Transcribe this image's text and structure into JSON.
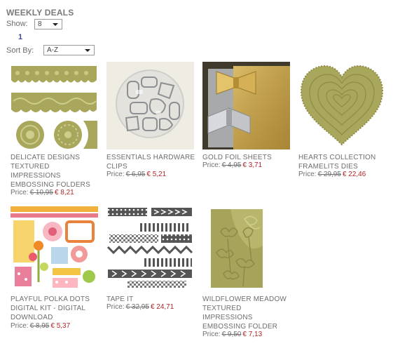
{
  "header": {
    "title": "WEEKLY DEALS"
  },
  "controls": {
    "show_label": "Show:",
    "show_value": "8",
    "page_number": "1",
    "sort_label": "Sort By:",
    "sort_value": "A-Z"
  },
  "colors": {
    "olive": "#a6a35a",
    "price_red": "#b0262a",
    "page_link": "#3d4a8c"
  },
  "products": [
    {
      "name": "DELICATE DESIGNS TEXTURED IMPRESSIONS EMBOSSING FOLDERS",
      "price_label": "Price:",
      "old_price": "€ 10,95",
      "new_price": "€ 8,21",
      "icon": "embossing-folders-image"
    },
    {
      "name": "ESSENTIALS HARDWARE CLIPS",
      "price_label": "Price:",
      "old_price": "€ 6,95",
      "new_price": "€ 5,21",
      "icon": "hardware-clips-image"
    },
    {
      "name": "GOLD FOIL SHEETS",
      "price_label": "Price:",
      "old_price": "€ 4,95",
      "new_price": "€ 3,71",
      "icon": "gold-foil-bows-image"
    },
    {
      "name": "HEARTS COLLECTION FRAMELITS DIES",
      "price_label": "Price:",
      "old_price": "€ 29,95",
      "new_price": "€ 22,46",
      "icon": "heart-dies-image"
    },
    {
      "name": "PLAYFUL POLKA DOTS DIGITAL KIT - DIGITAL DOWNLOAD",
      "price_label": "Price:",
      "old_price": "€ 8,95",
      "new_price": "€ 5,37",
      "icon": "digital-kit-image"
    },
    {
      "name": "TAPE IT",
      "price_label": "Price:",
      "old_price": "€ 32,95",
      "new_price": "€ 24,71",
      "icon": "tape-strips-image"
    },
    {
      "name": "WILDFLOWER MEADOW TEXTURED IMPRESSIONS EMBOSSING FOLDER",
      "price_label": "Price:",
      "old_price": "€ 9,50",
      "new_price": "€ 7,13",
      "icon": "wildflower-folder-image"
    }
  ]
}
